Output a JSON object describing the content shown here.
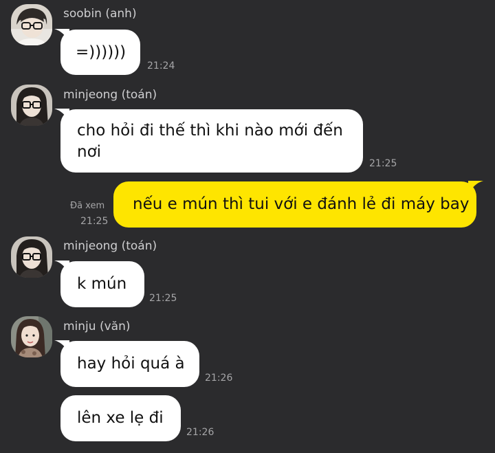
{
  "messages": [
    {
      "sender": "soobin (anh)",
      "avatar": "avatar-soobin",
      "text": "=))))))",
      "time": "21:24"
    },
    {
      "sender": "minjeong (toán)",
      "avatar": "avatar-minjeong",
      "lines": [
        "cho hỏi đi thế thì khi nào mới đến",
        "nơi"
      ],
      "time": "21:25"
    },
    {
      "self": true,
      "read_label": "Đã xem",
      "text": "nếu e mún thì tui với e đánh lẻ đi máy bay",
      "time": "21:25"
    },
    {
      "sender": "minjeong (toán)",
      "avatar": "avatar-minjeong",
      "text": "k mún",
      "time": "21:25"
    },
    {
      "sender": "minju (văn)",
      "avatar": "avatar-minju",
      "text": "hay hỏi quá à",
      "time": "21:26"
    },
    {
      "text": "lên xe lẹ đi",
      "time": "21:26"
    }
  ],
  "colors": {
    "background": "#2b2b2d",
    "incoming_bubble": "#ffffff",
    "outgoing_bubble": "#fee500",
    "meta_text": "#a6a6a8"
  }
}
